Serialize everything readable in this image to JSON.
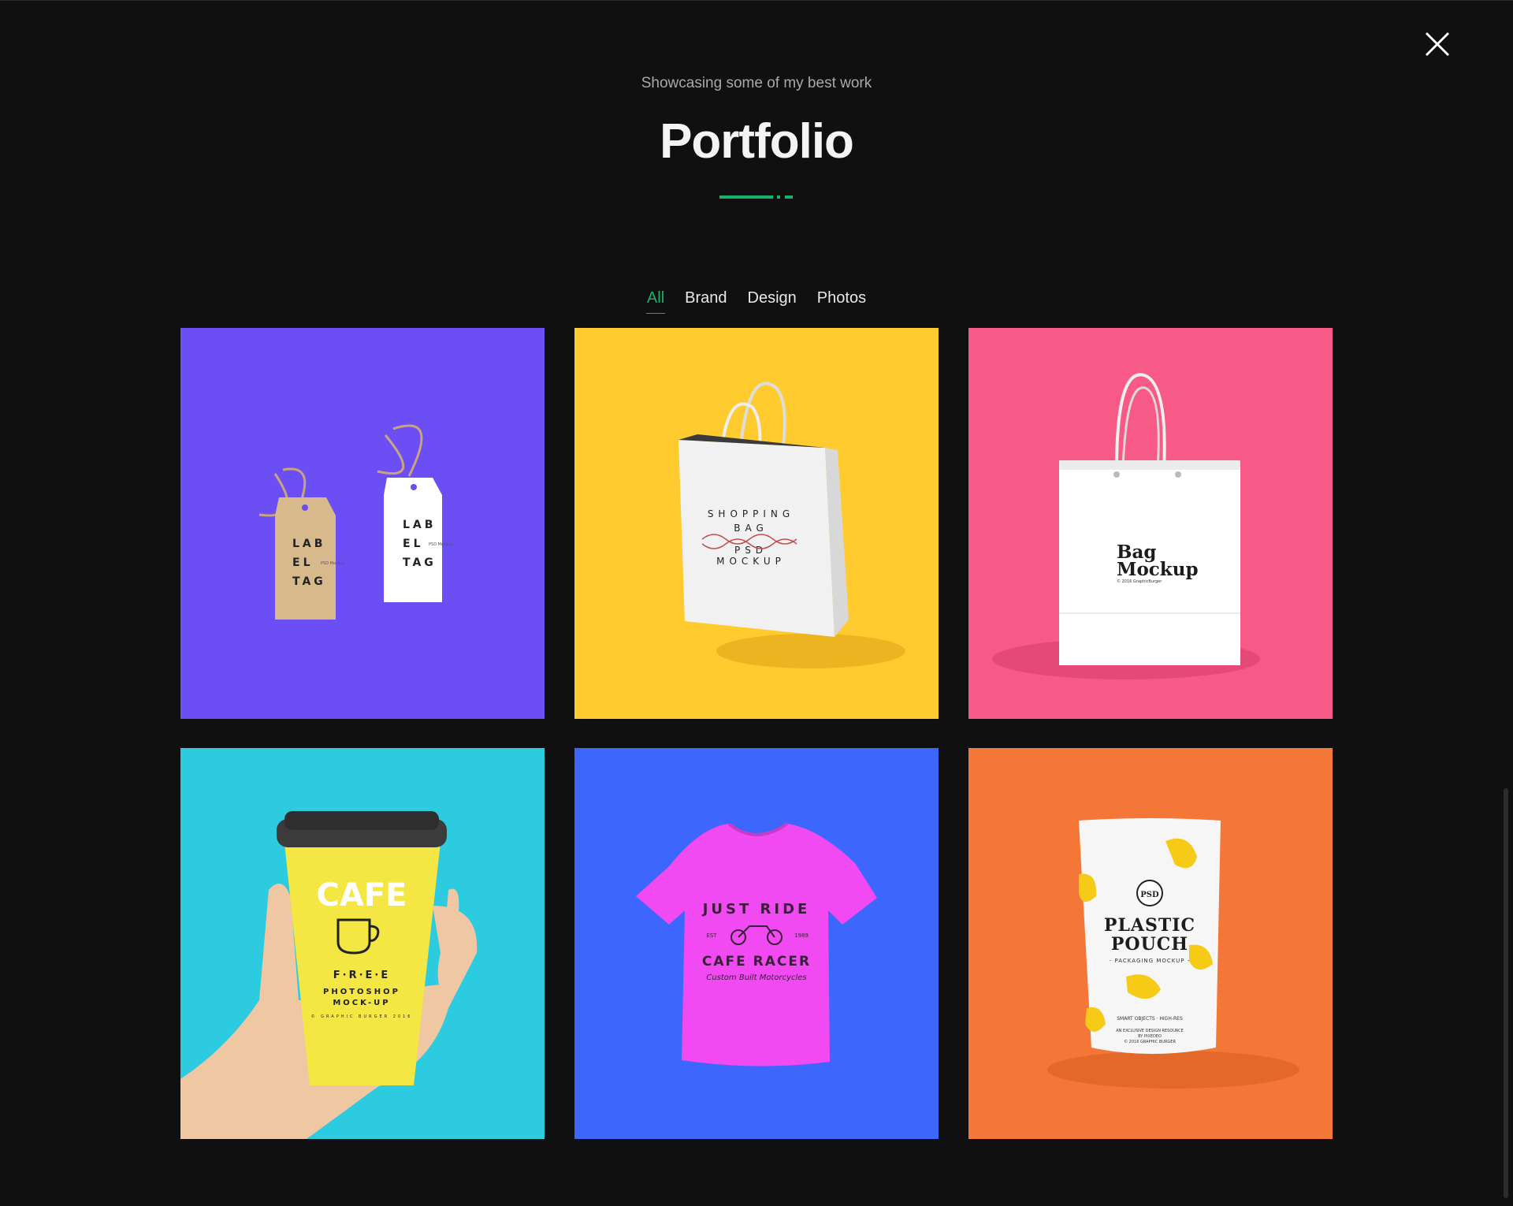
{
  "header": {
    "subtitle": "Showcasing some of my best work",
    "title": "Portfolio"
  },
  "accent_color": "#16b26a",
  "filters": [
    {
      "label": "All",
      "active": true
    },
    {
      "label": "Brand",
      "active": false
    },
    {
      "label": "Design",
      "active": false
    },
    {
      "label": "Photos",
      "active": false
    }
  ],
  "items": [
    {
      "bg": "#6b4ef4",
      "product": "label-tag",
      "lines": [
        "LAB",
        "EL",
        "TAG"
      ],
      "small": "PSD Mockup"
    },
    {
      "bg": "#ffcb2f",
      "product": "shopping-bag",
      "lines": [
        "SHOPPING",
        "BAG",
        "MOCKUP",
        "PSD"
      ]
    },
    {
      "bg": "#f85a87",
      "product": "bag-mockup",
      "lines": [
        "Bag",
        "Mockup"
      ],
      "small": "© 2016 GraphicBurger"
    },
    {
      "bg": "#2ccbe0",
      "product": "coffee-cup",
      "lines": [
        "CAFE",
        "F·R·E·E",
        "PHOTOSHOP",
        "MOCK-UP"
      ],
      "small": "© GRAPHIC BURGER 2016"
    },
    {
      "bg": "#3d66fd",
      "product": "t-shirt",
      "lines": [
        "JUST RIDE",
        "CAFE RACER"
      ],
      "small": "Custom Built Motorcycles",
      "est": [
        "EST",
        "1989"
      ]
    },
    {
      "bg": "#f47737",
      "product": "plastic-pouch",
      "lines": [
        "PSD",
        "PLASTIC",
        "POUCH",
        "- PACKAGING MOCKUP -"
      ],
      "small": [
        "SMART OBJECTS · HIGH-RES",
        "AN EXCLUSIVE DESIGN RESOURCE",
        "BY PIXEDEO",
        "© 2016 GRAPHIC BURGER"
      ]
    }
  ]
}
